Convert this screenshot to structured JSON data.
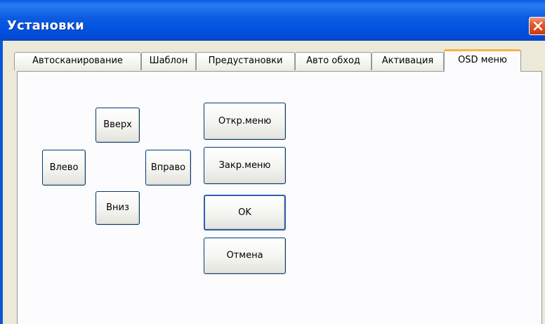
{
  "window": {
    "title": "Установки"
  },
  "tabs": [
    {
      "label": "Автосканирование",
      "active": false
    },
    {
      "label": "Шаблон",
      "active": false
    },
    {
      "label": "Предустановки",
      "active": false
    },
    {
      "label": "Авто обход",
      "active": false
    },
    {
      "label": "Активация",
      "active": false
    },
    {
      "label": "OSD меню",
      "active": true
    }
  ],
  "osd": {
    "up_label": "Вверх",
    "left_label": "Влево",
    "right_label": "Вправо",
    "down_label": "Вниз",
    "open_menu_label": "Откр.меню",
    "close_menu_label": "Закр.меню"
  },
  "dialog": {
    "ok_label": "OK",
    "cancel_label": "Отмена"
  },
  "colors": {
    "titlebar": "#0a5ce5",
    "close_button": "#e2582e",
    "active_tab_accent": "#f5b34c",
    "button_border": "#003c74"
  }
}
